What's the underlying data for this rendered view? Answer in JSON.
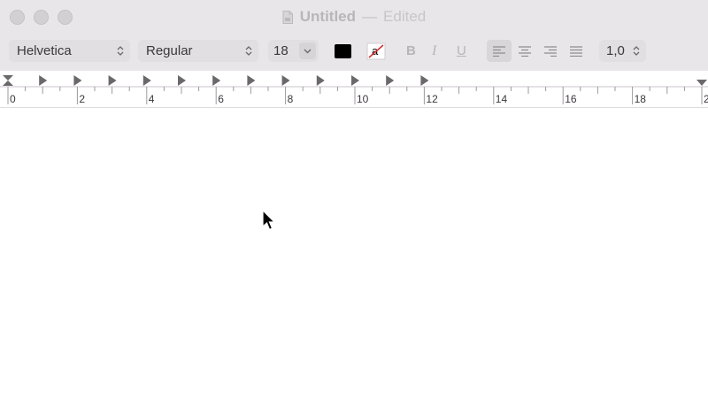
{
  "window": {
    "title": "Untitled",
    "separator": "—",
    "status": "Edited",
    "icons": {
      "document": "document-icon"
    }
  },
  "toolbar": {
    "font_family": "Helvetica",
    "font_style": "Regular",
    "font_size": "18",
    "text_color": "#000000",
    "bold_label": "B",
    "italic_label": "I",
    "underline_label": "U",
    "line_spacing": "1,0",
    "alignment_selected": "left"
  },
  "ruler": {
    "labels": [
      "0",
      "2",
      "4",
      "6",
      "8",
      "10",
      "12",
      "14",
      "16",
      "18",
      "2"
    ]
  },
  "document": {
    "text": ""
  }
}
